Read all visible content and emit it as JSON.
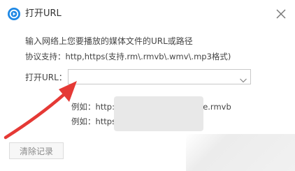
{
  "window": {
    "title": "打开URL",
    "app_icon": "player-logo-icon",
    "close_icon": "close-icon"
  },
  "instruction": "输入网络上您要播放的媒体文件的URL或路径",
  "protocol_support": "协议支持：http,https(支持.rm\\.rmvb\\.wmv\\.mp3格式)",
  "url_field": {
    "label": "打开URL：",
    "value": "",
    "placeholder": ""
  },
  "examples": {
    "line1_prefix": "例如：http:/",
    "line1_suffix": "le.rmvb",
    "line2_prefix": "例如：https:/"
  },
  "buttons": {
    "clear_history": "清除记录"
  },
  "colors": {
    "accent": "#1e88e5",
    "annotation_arrow": "#e53935",
    "text": "#444444"
  }
}
